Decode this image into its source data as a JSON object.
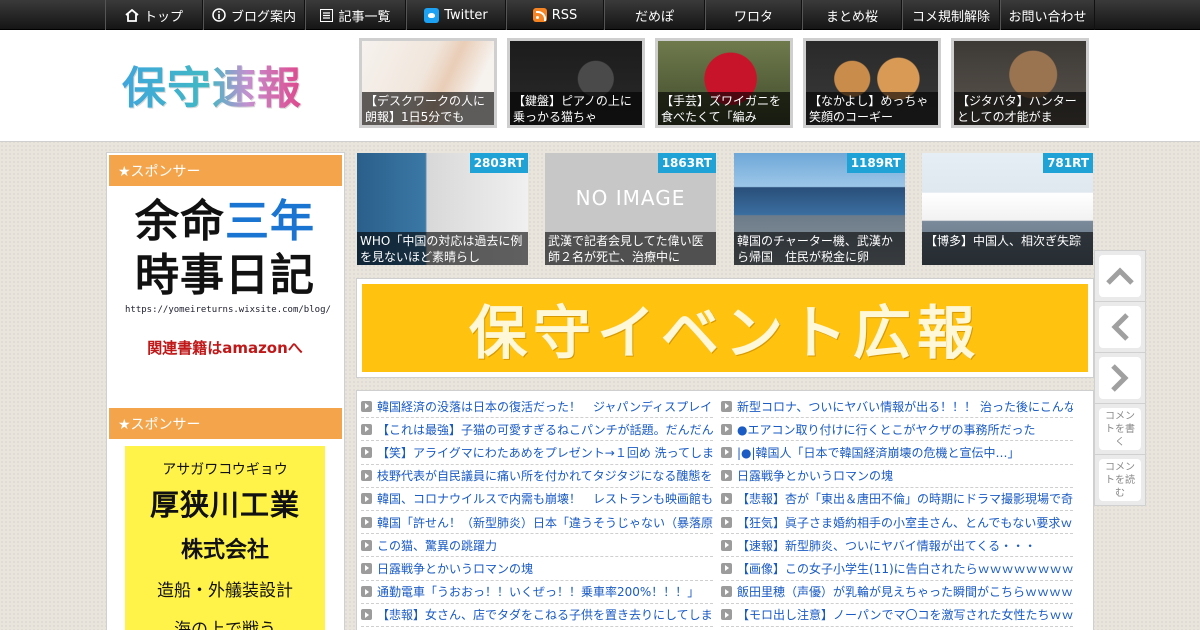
{
  "nav": {
    "items": [
      {
        "icon": "home-icon",
        "label": "トップ"
      },
      {
        "icon": "info-icon",
        "label": "ブログ案内"
      },
      {
        "icon": "list-icon",
        "label": "記事一覧"
      },
      {
        "icon": "twitter-icon",
        "label": "Twitter"
      },
      {
        "icon": "rss-icon",
        "label": "RSS"
      },
      {
        "icon": "",
        "label": "だめぽ"
      },
      {
        "icon": "",
        "label": "ワロタ"
      },
      {
        "icon": "",
        "label": "まとめ桜"
      },
      {
        "icon": "",
        "label": "コメ規制解除"
      },
      {
        "icon": "",
        "label": "お問い合わせ"
      }
    ]
  },
  "header": {
    "logo_text": "保守速報",
    "thumbs": [
      {
        "caption": "【デスクワークの人に朗報】1日5分でも"
      },
      {
        "caption": "【鍵盤】ピアノの上に乗っかる猫ちゃ"
      },
      {
        "caption": "【手芸】ズワイガニを食べたくて「編み"
      },
      {
        "caption": "【なかよし】めっちゃ笑顔のコーギー"
      },
      {
        "caption": "【ジタバタ】ハンターとしての才能がま"
      }
    ]
  },
  "sidebar": {
    "sponsor1_label": "★スポンサー",
    "ad1": {
      "line1_a": "余命",
      "line1_b": "三年",
      "line2": "時事日記",
      "url": "https://yomeireturns.wixsite.com/blog/",
      "amazon": "関連書籍はamazonへ"
    },
    "sponsor2_label": "★スポンサー",
    "ad2": {
      "kana": "アサガワコウギョウ",
      "name": "厚狭川工業",
      "corp": "株式会社",
      "business": "造船・外艤装設計",
      "more": "海の上で戦う"
    }
  },
  "ranking": [
    {
      "count": "2803RT",
      "caption": "WHO「中国の対応は過去に例を見ないほど素晴らし"
    },
    {
      "count": "1863RT",
      "caption": "武漢で記者会見してた偉い医師２名が死亡、治療中に",
      "placeholder": "NO IMAGE"
    },
    {
      "count": "1189RT",
      "caption": "韓国のチャーター機、武漢から帰国　住民が税金に卵"
    },
    {
      "count": "781RT",
      "caption": "【博多】中国人、相次ぎ失踪"
    }
  ],
  "banner": {
    "text": "保守イベント広報"
  },
  "articles": {
    "left": [
      "韓国経済の没落は日本の復活だった！　ジャパンディスプレイ",
      "【これは最強】子猫の可愛すぎるねこパンチが話題。だんだん",
      "【笑】アライグマにわたあめをプレゼント→１回め 洗ってしま",
      "枝野代表が自民議員に痛い所を付かれてタジタジになる醜態を",
      "韓国、コロナウイルスで内需も崩壊！　レストランも映画館も",
      "韓国「許せん！（新型肺炎）日本「違うそうじゃない（暴落原",
      "この猫、驚異の跳躍力",
      "日露戦争とかいうロマンの塊",
      "通勤電車「うおおっ！！いくぜっ！！乗車率200%！！！」",
      "【悲報】女さん、店でタダをこねる子供を置き去りにしてしま"
    ],
    "right": [
      "新型コロナ、ついにヤバい情報が出る！！！ 治った後にこんな",
      "●エアコン取り付けに行くとこがヤクザの事務所だった",
      "|●|韓国人「日本で韓国経済崩壊の危機と宣伝中…」",
      "日露戦争とかいうロマンの塊",
      "【悲報】杏が「東出＆唐田不倫」の時期にドラマ撮影現場で奇",
      "【狂気】眞子さま婚約相手の小室圭さん、とんでもない要求ｗ",
      "【速報】新型肺炎、ついにヤバイ情報が出てくる・・・",
      "【画像】この女子小学生(11)に告白されたらｗｗｗｗｗｗｗｗ",
      "飯田里穂（声優）が乳輪が見えちゃった瞬間がこちらｗｗｗｗ",
      "【モロ出し注意】ノーパンでマ〇コを激写された女性たちｗｗ"
    ]
  },
  "floating": {
    "comment_write": "コメントを書く",
    "comment_read": "コメントを読む"
  },
  "colors": {
    "sponsor_header": "#f4a54c",
    "link": "#1a5bc4",
    "badge": "#1fa3d6",
    "banner": "#ffc20e",
    "ad_yellow": "#fff34a"
  }
}
